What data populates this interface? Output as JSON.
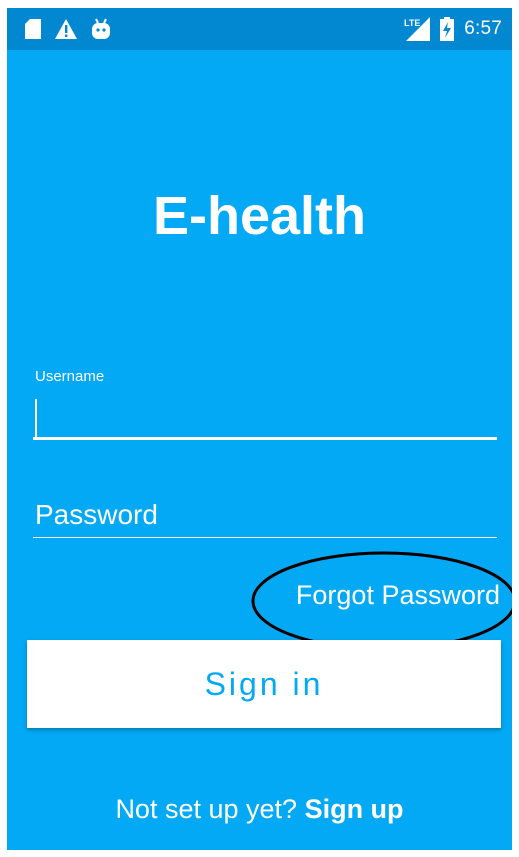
{
  "status_bar": {
    "time": "6:57",
    "network_label": "LTE",
    "left_icons": [
      "sd-card-icon",
      "warning-icon",
      "android-icon"
    ],
    "right_icons": [
      "lte-signal-icon",
      "battery-charging-icon"
    ]
  },
  "app": {
    "title": "E-health"
  },
  "login_form": {
    "username_label": "Username",
    "username_value": "",
    "password_placeholder": "Password",
    "password_value": "",
    "forgot_password_label": "Forgot Password",
    "sign_in_label": "Sign in"
  },
  "signup_prompt": {
    "text": "Not set up yet?",
    "link_label": "Sign up"
  },
  "colors": {
    "background": "#03A9F4",
    "status_bar": "#0288D1",
    "text": "#ffffff",
    "button_text": "#03A9F4",
    "annotation": "#000000"
  }
}
